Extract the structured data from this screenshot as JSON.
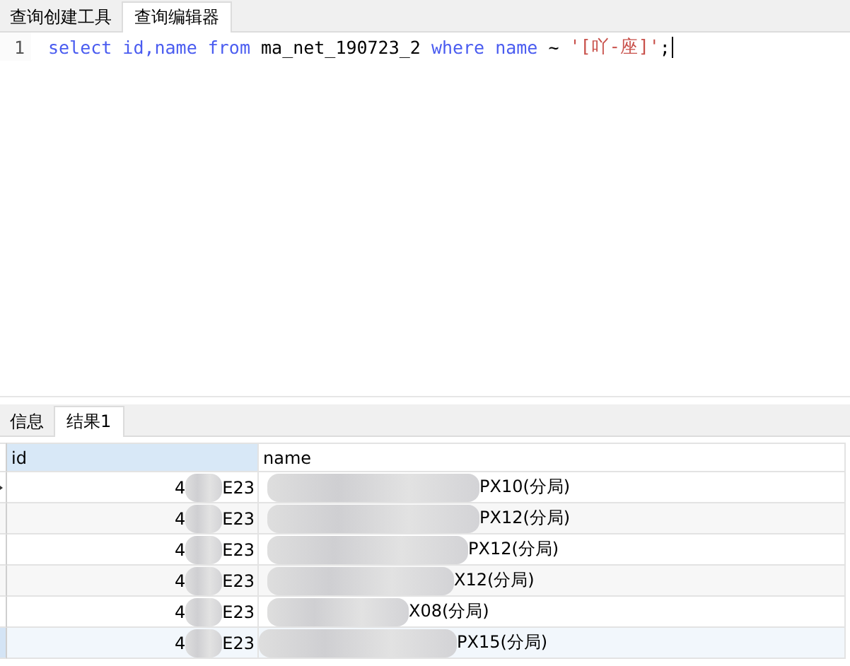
{
  "editor_tabs": [
    {
      "label": "查询创建工具",
      "selected": false
    },
    {
      "label": "查询编辑器",
      "selected": true
    }
  ],
  "editor": {
    "lines": [
      {
        "number": "1",
        "tokens": [
          {
            "kind": "keyword",
            "text": "select id,name from"
          },
          {
            "kind": "plain",
            "text": " ma_net_190723_2 "
          },
          {
            "kind": "keyword",
            "text": "where name"
          },
          {
            "kind": "plain",
            "text": " ~ "
          },
          {
            "kind": "string",
            "text": "'[吖-座]'"
          },
          {
            "kind": "plain",
            "text": ";"
          }
        ]
      }
    ]
  },
  "result_tabs": [
    {
      "label": "信息",
      "selected": false
    },
    {
      "label": "结果1",
      "selected": true
    }
  ],
  "table": {
    "columns": [
      "id",
      "name"
    ],
    "rows": [
      {
        "id_start": "4",
        "id_end": "E23",
        "name_end": "PX10(分局)",
        "current": true,
        "hovered": false
      },
      {
        "id_start": "4",
        "id_end": "E23",
        "name_end": "PX12(分局)",
        "current": false,
        "hovered": false
      },
      {
        "id_start": "4",
        "id_end": "E23",
        "name_end": "PX12(分局)",
        "current": false,
        "hovered": false
      },
      {
        "id_start": "4",
        "id_end": "E23",
        "name_end": "X12(分局)",
        "current": false,
        "hovered": false
      },
      {
        "id_start": "4",
        "id_end": "E23",
        "name_end": "X08(分局)",
        "current": false,
        "hovered": false
      },
      {
        "id_start": "4",
        "id_end": "E23",
        "name_end": "PX15(分局)",
        "current": false,
        "hovered": true
      }
    ]
  }
}
